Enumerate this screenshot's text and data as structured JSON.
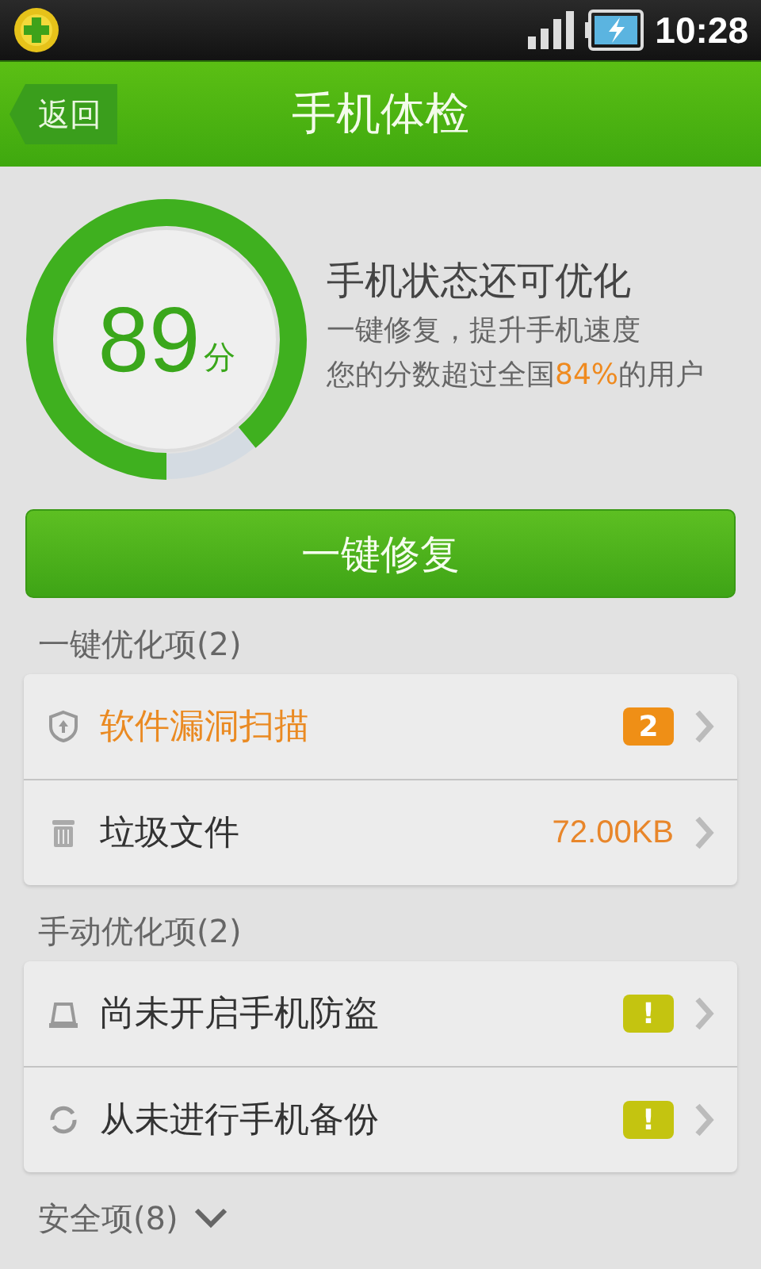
{
  "status_bar": {
    "time": "10:28"
  },
  "header": {
    "back": "返回",
    "title": "手机体检"
  },
  "score": {
    "value": "89",
    "unit": "分",
    "level": 0.89,
    "headline": "手机状态还可优化",
    "hint": "一键修复，提升手机速度",
    "beat": {
      "before": "您的分数超过全国",
      "percent": "84%",
      "after": "的用户"
    }
  },
  "fix_button": "一键修复",
  "sections": [
    {
      "title": "一键优化项(2)",
      "expanded": true,
      "items": [
        {
          "kind": "badge",
          "label": "软件漏洞扫描",
          "highlighted": true,
          "badge": "2"
        },
        {
          "kind": "value",
          "label": "垃圾文件",
          "highlighted": false,
          "value": "72.00KB"
        }
      ]
    },
    {
      "title": "手动优化项(2)",
      "expanded": true,
      "items": [
        {
          "kind": "alert",
          "label": "尚未开启手机防盗",
          "highlighted": false,
          "badge": "!"
        },
        {
          "kind": "alert",
          "label": "从未进行手机备份",
          "highlighted": false,
          "badge": "!"
        }
      ]
    },
    {
      "title": "安全项(8)",
      "expanded": false
    }
  ]
}
